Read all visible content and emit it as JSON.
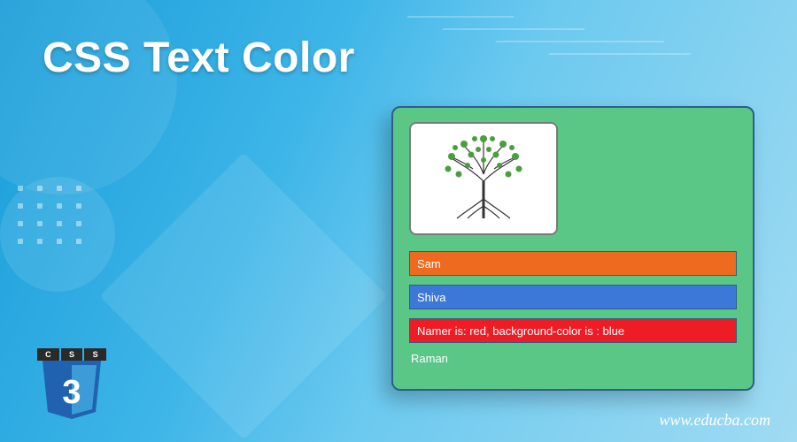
{
  "title": "CSS Text Color",
  "panel": {
    "bar1": "Sam",
    "bar2": "Shiva",
    "bar3": "Namer is: red, background-color is : blue",
    "plain": "Raman"
  },
  "colors": {
    "bar1_bg": "#ed6a1f",
    "bar2_bg": "#3c78d8",
    "bar3_bg": "#ee1c25",
    "panel_bg": "#5ac787"
  },
  "css3_logo": {
    "c": "C",
    "s1": "S",
    "s2": "S",
    "three": "3"
  },
  "site_url": "www.educba.com"
}
